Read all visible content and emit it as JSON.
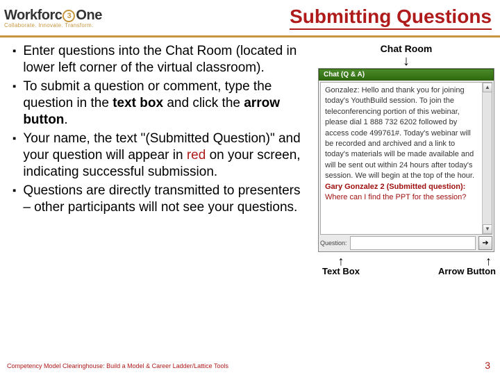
{
  "header": {
    "logo_text_a": "Workforc",
    "logo_text_b": "One",
    "tagline": "Collaborate. Innovate. Transform.",
    "title": "Submitting Questions"
  },
  "bullets": [
    {
      "pre": "Enter questions into the Chat Room (located in lower left corner of the virtual classroom)."
    },
    {
      "pre": "To submit a question or comment, type the question in the ",
      "b1": "text box",
      "mid": " and click the ",
      "b2": "arrow button",
      "post": "."
    },
    {
      "pre": "Your name, the text \"(Submitted Question)\" and your question will appear in ",
      "red": "red",
      "post": " on your screen, indicating successful submission."
    },
    {
      "pre": "Questions are directly transmitted to presenters – other participants will not see your questions."
    }
  ],
  "right": {
    "chat_room_label": "Chat Room",
    "panel_title": "Chat (Q & A)",
    "chat_text": "Gonzalez: Hello and thank you for joining today's YouthBuild session. To join the teleconferencing portion of this webinar, please dial 1 888 732 6202 followed by access code 499761#. Today's webinar will be recorded and archived and a link to today's materials will be made available and will be sent out within 24 hours after today's session. We will begin at the top of the hour.",
    "chat_red_name": "Gary Gonzalez 2 (Submitted question): ",
    "chat_red_q": "Where can I find the PPT for the session?",
    "input_label": "Question:",
    "arrow_glyph": "➔",
    "text_box_label": "Text Box",
    "arrow_button_label": "Arrow Button"
  },
  "footer": {
    "left": "Competency Model Clearinghouse: Build a Model & Career Ladder/Lattice Tools",
    "page": "3"
  }
}
